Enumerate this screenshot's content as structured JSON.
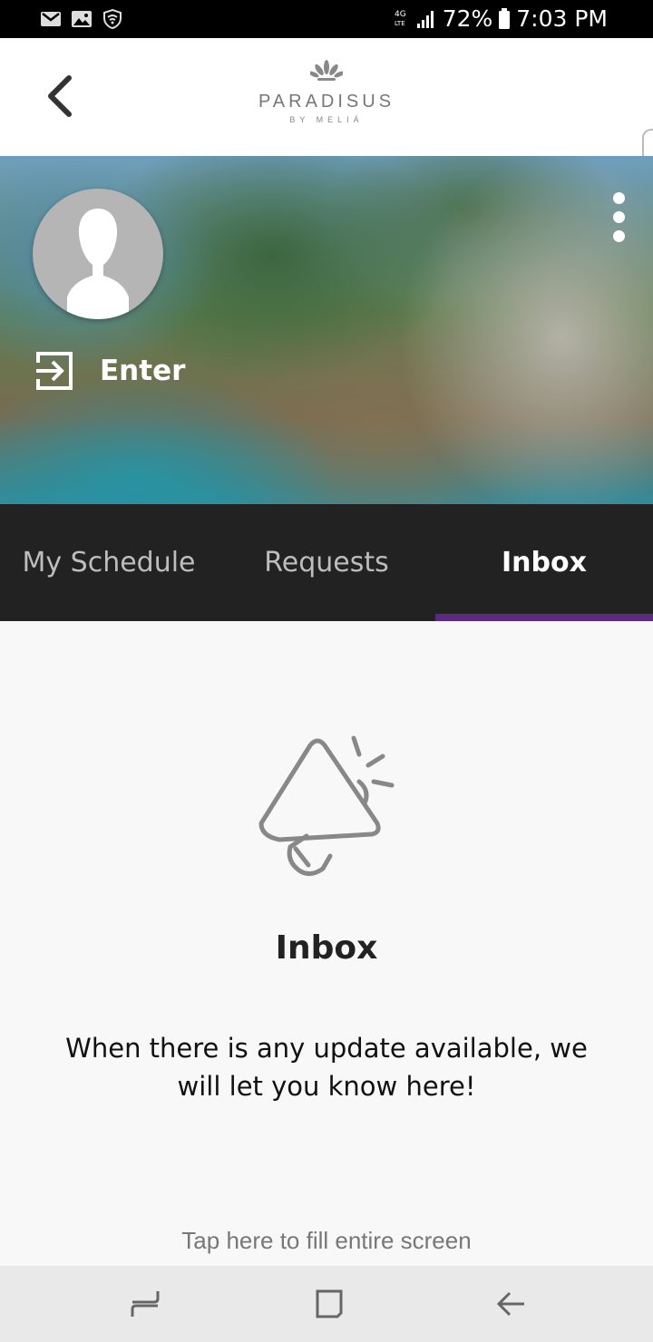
{
  "status_bar": {
    "battery": "72%",
    "time": "7:03 PM",
    "left_icons": [
      "gmail-icon",
      "gallery-icon",
      "shield-wifi-icon"
    ],
    "right_icons": [
      "4g-lte-icon",
      "signal-icon",
      "battery-icon"
    ]
  },
  "header": {
    "logo_text": "PARADISUS",
    "logo_subtext": "BY MELIÁ",
    "back_icon": "chevron-left-icon"
  },
  "profile": {
    "enter_label": "Enter",
    "menu_icon": "more-vertical-icon"
  },
  "tabs": [
    {
      "label": "My Schedule",
      "active": false
    },
    {
      "label": "Requests",
      "active": false
    },
    {
      "label": "Inbox",
      "active": true
    }
  ],
  "empty_state": {
    "icon": "megaphone-icon",
    "title": "Inbox",
    "message": "When there is any update available, we will let you know here!"
  },
  "fill_hint": "Tap here to fill entire screen",
  "nav_bar": {
    "buttons": [
      "recents-icon",
      "home-icon",
      "back-icon"
    ]
  },
  "colors": {
    "tab_indicator": "#5a2a82",
    "tab_bar": "#222222"
  }
}
